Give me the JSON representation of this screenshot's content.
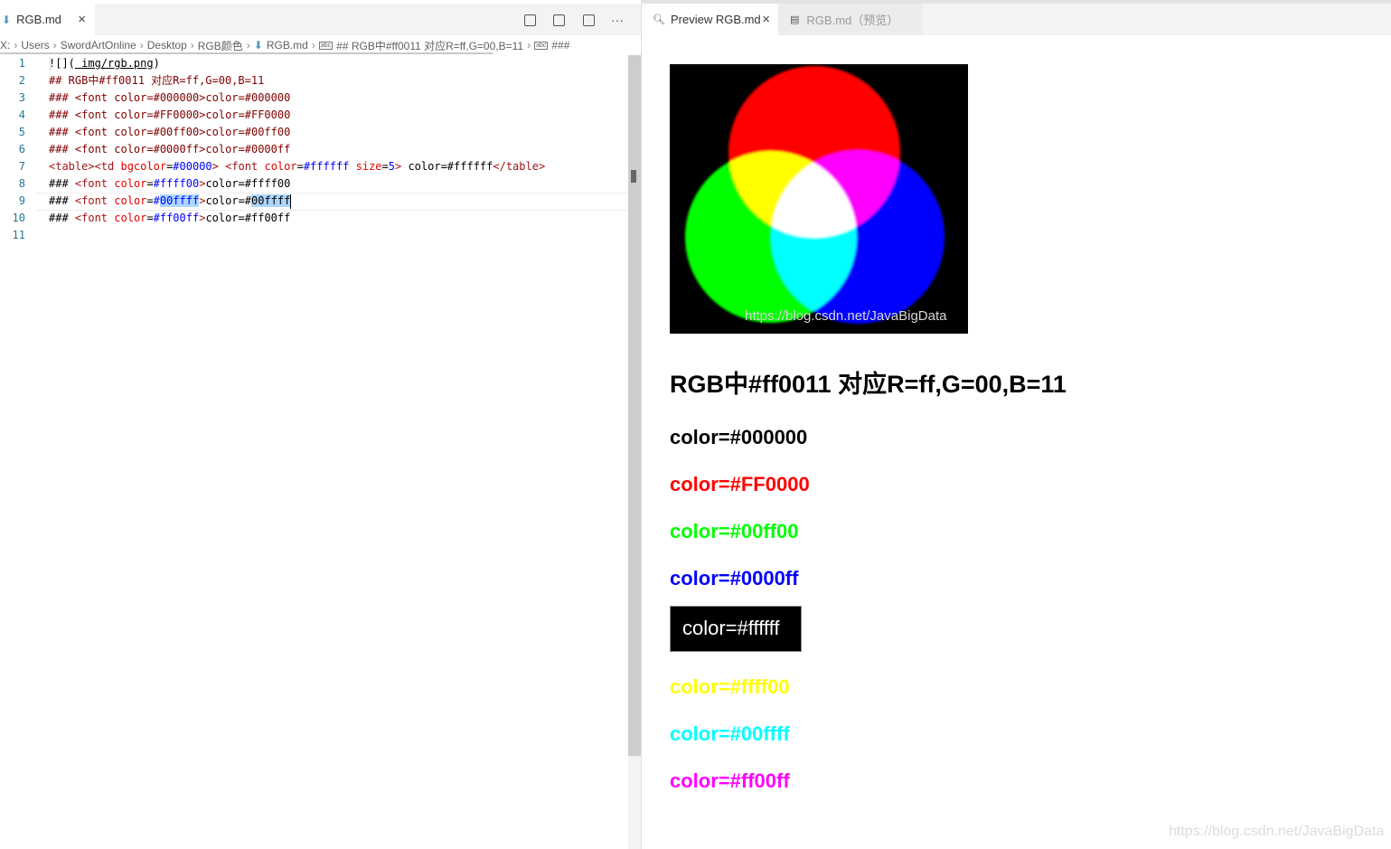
{
  "editor": {
    "tab": {
      "label": "RGB.md",
      "icon": "markdown-icon",
      "close": "×"
    },
    "toolbar": {
      "icons": [
        "open-preview-icon",
        "open-preview-side-icon",
        "split-editor-icon",
        "more-actions-icon"
      ],
      "more": "···"
    },
    "breadcrumb": [
      "X:",
      "Users",
      "SwordArtOnline",
      "Desktop",
      "RGB颜色",
      "RGB.md",
      "## RGB中#ff0011 对应R=ff,G=00,B=11",
      "###"
    ],
    "breadcrumb_sep": "›",
    "line_numbers": [
      "1",
      "2",
      "3",
      "4",
      "5",
      "6",
      "7",
      "8",
      "9",
      "10",
      "11"
    ],
    "lines": {
      "l1": {
        "a": "![](",
        "b": " img/rgb.png",
        "c": ")"
      },
      "l2": "## RGB中#ff0011 对应R=ff,G=00,B=11",
      "l3": "### <font color=#000000>color=#000000",
      "l4": "### <font color=#FF0000>color=#FF0000",
      "l5": "### <font color=#00ff00>color=#00ff00",
      "l6": "### <font color=#0000ff>color=#0000ff",
      "l7": {
        "tag1": "<table><td ",
        "attr1": "bgcolor",
        "eq1": "=",
        "val1": "#00000",
        "tag1end": "> ",
        "tag2": "<font ",
        "attr2": "color",
        "eq2": "=",
        "val2": "#ffffff",
        "attr3": " size",
        "eq3": "=",
        "val3": "5",
        "tag2end": "> ",
        "text": "color=#ffffff",
        "tag3": "</table>"
      },
      "l8": {
        "hash": "### ",
        "tag": "<font ",
        "attr": "color",
        "eq": "=",
        "val": "#ffff00",
        "end": ">",
        "text": "color=#ffff00"
      },
      "l9": {
        "hash": "### ",
        "tag": "<font ",
        "attr": "color",
        "eq": "=",
        "val_prefix": "#",
        "val_sel": "00ffff",
        "end": ">",
        "text_prefix": "color=#",
        "text_sel": "00ffff"
      },
      "l10": {
        "hash": "### ",
        "tag": "<font ",
        "attr": "color",
        "eq": "=",
        "val": "#ff00ff",
        "end": ">",
        "text": "color=#ff00ff"
      }
    }
  },
  "preview": {
    "tabs": [
      {
        "label": "Preview RGB.md",
        "icon": "preview-icon",
        "close": "×"
      },
      {
        "label": "RGB.md（预览）",
        "icon": "preview-doc-icon"
      }
    ],
    "image_watermark": "https://blog.csdn.net/JavaBigData",
    "h2": "RGB中#ff0011 对应R=ff,G=00,B=11",
    "headings": [
      {
        "text": "color=#000000",
        "color": "#000000"
      },
      {
        "text": "color=#FF0000",
        "color": "#FF0000"
      },
      {
        "text": "color=#00ff00",
        "color": "#00ff00"
      },
      {
        "text": "color=#0000ff",
        "color": "#0000ff"
      }
    ],
    "table_cell": "color=#ffffff",
    "headings2": [
      {
        "text": "color=#ffff00",
        "color": "#ffff00"
      },
      {
        "text": "color=#00ffff",
        "color": "#00ffff"
      },
      {
        "text": "color=#ff00ff",
        "color": "#ff00ff"
      }
    ]
  },
  "page_watermark": "https://blog.csdn.net/JavaBigData"
}
